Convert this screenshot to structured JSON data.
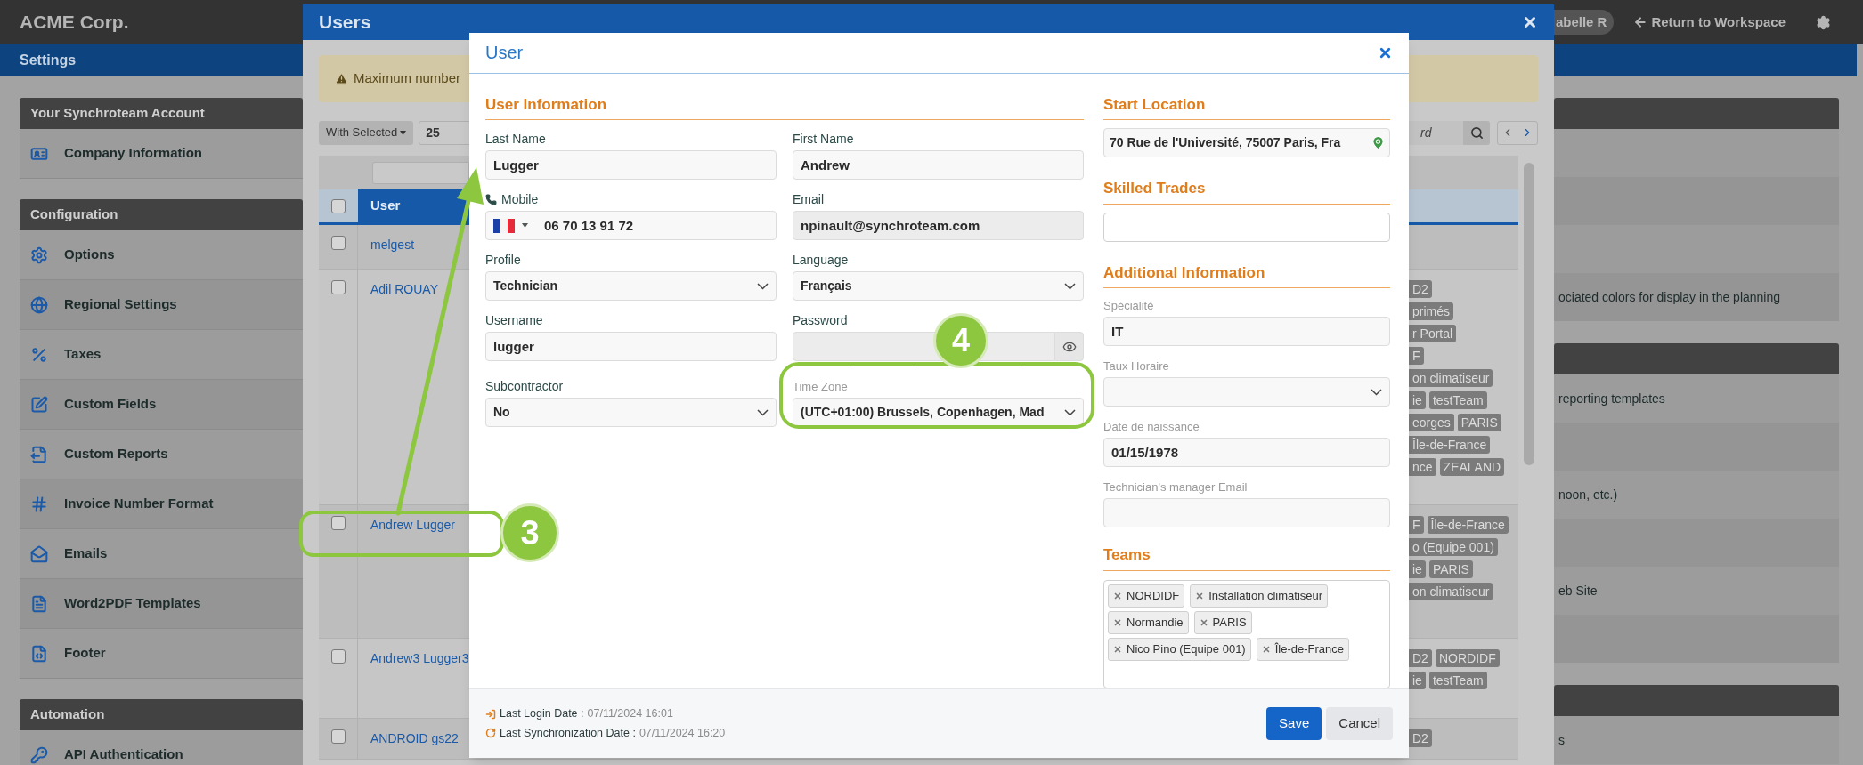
{
  "top_bar": {
    "brand": "ACME Corp.",
    "user_pill": "abelle R",
    "return_link": "Return to Workspace"
  },
  "section_bar": {
    "title": "Settings"
  },
  "sidebar": {
    "groups": [
      {
        "title": "Your Synchroteam Account",
        "items": [
          "Company Information"
        ]
      },
      {
        "title": "Configuration",
        "items": [
          "Options",
          "Regional Settings",
          "Taxes",
          "Custom Fields",
          "Custom Reports",
          "Invoice Number Format",
          "Emails",
          "Word2PDF Templates",
          "Footer"
        ]
      },
      {
        "title": "Automation",
        "items": [
          "API Authentication"
        ]
      }
    ]
  },
  "right_panels": [
    {
      "texts": [
        "ociated colors for display in the planning"
      ]
    },
    {
      "texts": [
        "reporting templates",
        "noon, etc.)",
        "eb Site"
      ]
    },
    {
      "texts": [
        "s"
      ]
    }
  ],
  "users_panel": {
    "title": "Users",
    "alert": "Maximum number",
    "bulk_button": "With Selected",
    "page_size": "25",
    "search_placeholder": "rd",
    "table": {
      "header": "User",
      "header_checked": false,
      "rows": [
        {
          "name": "melgest",
          "checked": false
        },
        {
          "name": "Adil ROUAY",
          "checked": false,
          "tag_lines": [
            [
              "D2"
            ],
            [
              "primés"
            ],
            [
              "r Portal"
            ],
            [
              "F"
            ],
            [
              "on climatiseur"
            ],
            [
              "ie",
              "testTeam"
            ],
            [
              "eorges",
              "PARIS"
            ],
            [
              "Île-de-France"
            ],
            [
              "nce",
              "ZEALAND"
            ]
          ]
        },
        {
          "name": "Andrew Lugger",
          "checked": false,
          "tag_lines": [
            [
              "F",
              "Île-de-France"
            ],
            [
              "o (Equipe 001)"
            ],
            [
              "ie",
              "PARIS"
            ],
            [
              "on climatiseur"
            ]
          ]
        },
        {
          "name": "Andrew3 Lugger3",
          "checked": false,
          "tag_lines": [
            [
              "D2",
              "NORDIDF"
            ],
            [
              "ie",
              "testTeam"
            ]
          ]
        },
        {
          "name": "ANDROID gs22",
          "checked": false,
          "tag_lines": [
            [
              "D2"
            ]
          ]
        }
      ]
    }
  },
  "user_dialog": {
    "title": "User",
    "user_info": {
      "heading": "User Information",
      "fields": [
        {
          "label": "Last Name",
          "kind": "text",
          "value": "Lugger"
        },
        {
          "label": "First Name",
          "kind": "text",
          "value": "Andrew"
        },
        {
          "label": "Mobile",
          "kind": "phone",
          "value": "06 70 13 91 72"
        },
        {
          "label": "Email",
          "kind": "readonly",
          "value": "npinault@synchroteam.com"
        },
        {
          "label": "Profile",
          "kind": "select",
          "value": "Technician"
        },
        {
          "label": "Language",
          "kind": "select",
          "value": "Français"
        },
        {
          "label": "Username",
          "kind": "text",
          "value": "lugger"
        },
        {
          "label": "Password",
          "kind": "password"
        },
        {
          "label": "Subcontractor",
          "kind": "select",
          "value": "No"
        },
        {
          "label": "Time Zone",
          "kind": "select",
          "value": "(UTC+01:00) Brussels, Copenhagen, Mad",
          "muted_label": true
        }
      ]
    },
    "start_location": {
      "heading": "Start Location",
      "value": "70 Rue de l'Université, 75007 Paris, Fra"
    },
    "skilled_trades": {
      "heading": "Skilled Trades"
    },
    "additional_info": {
      "heading": "Additional Information",
      "fields": [
        {
          "label": "Spécialité",
          "kind": "text",
          "value": "IT",
          "muted_label": true
        },
        {
          "label": "Taux Horaire",
          "kind": "select",
          "muted_label": true
        },
        {
          "label": "Date de naissance",
          "kind": "text",
          "value": "01/15/1978",
          "muted_label": true
        },
        {
          "label": "Technician's manager Email",
          "kind": "text",
          "muted_label": true
        }
      ]
    },
    "teams": {
      "heading": "Teams",
      "tags": [
        "NORDIDF",
        "Installation climatiseur",
        "Normandie",
        "PARIS",
        "Nico Pino (Equipe 001)",
        "Île-de-France"
      ]
    },
    "footer": {
      "last_login": {
        "label": "Last Login Date :",
        "value": "07/11/2024 16:01"
      },
      "last_sync": {
        "label": "Last Synchronization Date :",
        "value": "07/11/2024 16:20"
      },
      "buttons": [
        {
          "label": "Save",
          "kind": "primary"
        },
        {
          "label": "Cancel",
          "kind": "secondary"
        }
      ]
    }
  },
  "annotations": [
    {
      "label": "3"
    },
    {
      "label": "4"
    }
  ]
}
